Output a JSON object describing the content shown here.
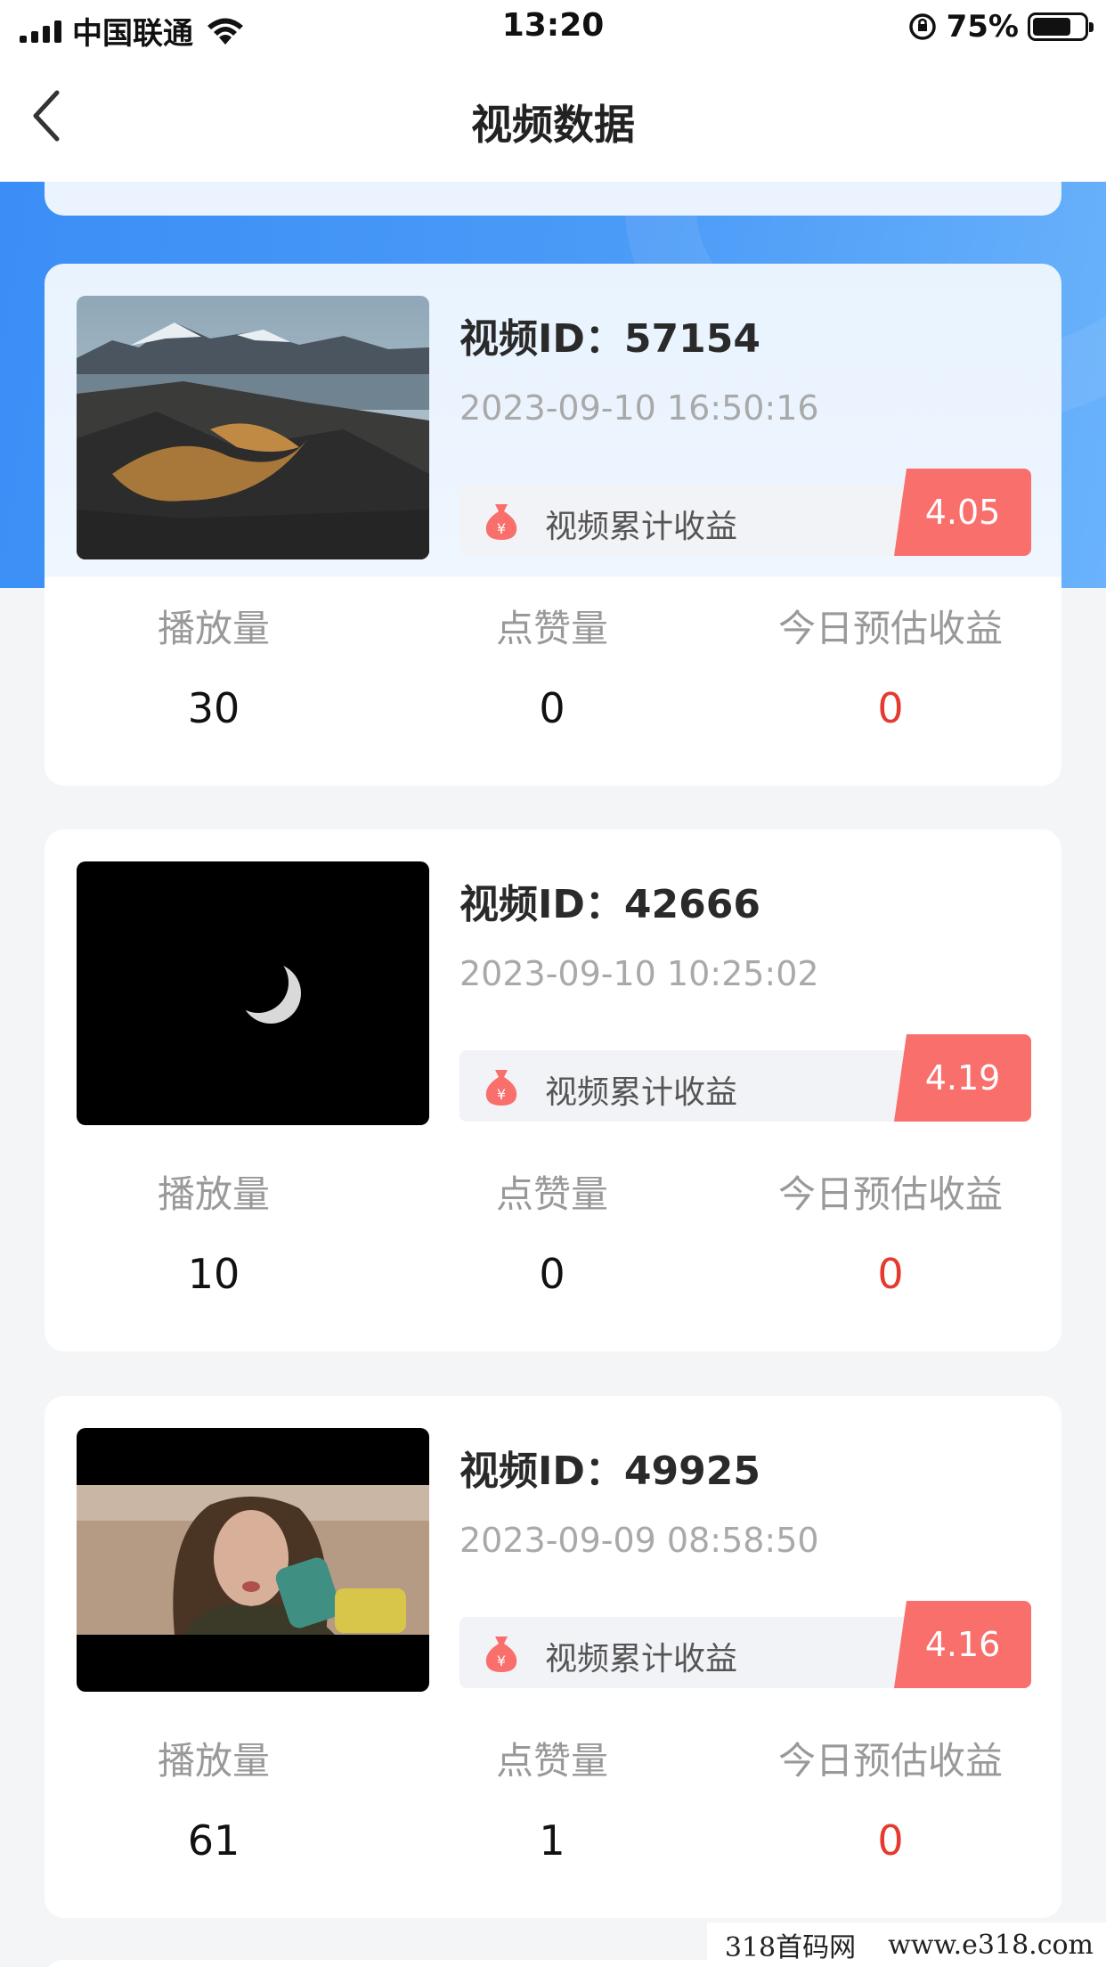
{
  "status_bar": {
    "carrier": "中国联通",
    "time": "13:20",
    "battery_percent": "75%",
    "battery_level": 0.75
  },
  "nav": {
    "title": "视频数据"
  },
  "videos": [
    {
      "id_label": "视频ID：57154",
      "date": "2023-09-10 16:50:16",
      "earnings_label": "视频累计收益",
      "earnings_value": "4.05",
      "thumbnail": "rocky-coast-mountains",
      "stats": [
        {
          "label": "播放量",
          "value": "30"
        },
        {
          "label": "点赞量",
          "value": "0"
        },
        {
          "label": "今日预估收益",
          "value": "0"
        }
      ]
    },
    {
      "id_label": "视频ID：42666",
      "date": "2023-09-10 10:25:02",
      "earnings_label": "视频累计收益",
      "earnings_value": "4.19",
      "thumbnail": "crescent-moon-night",
      "stats": [
        {
          "label": "播放量",
          "value": "10"
        },
        {
          "label": "点赞量",
          "value": "0"
        },
        {
          "label": "今日预估收益",
          "value": "0"
        }
      ]
    },
    {
      "id_label": "视频ID：49925",
      "date": "2023-09-09 08:58:50",
      "earnings_label": "视频累计收益",
      "earnings_value": "4.16",
      "thumbnail": "woman-drinking-bottle",
      "stats": [
        {
          "label": "播放量",
          "value": "61"
        },
        {
          "label": "点赞量",
          "value": "1"
        },
        {
          "label": "今日预估收益",
          "value": "0"
        }
      ]
    }
  ],
  "watermark": {
    "site_name": "318首码网",
    "url": "www.e318.com"
  },
  "colors": {
    "banner_blue": "#3a8ef6",
    "earnings_badge": "#f96f6c",
    "today_earnings_red": "#e53a2f"
  }
}
